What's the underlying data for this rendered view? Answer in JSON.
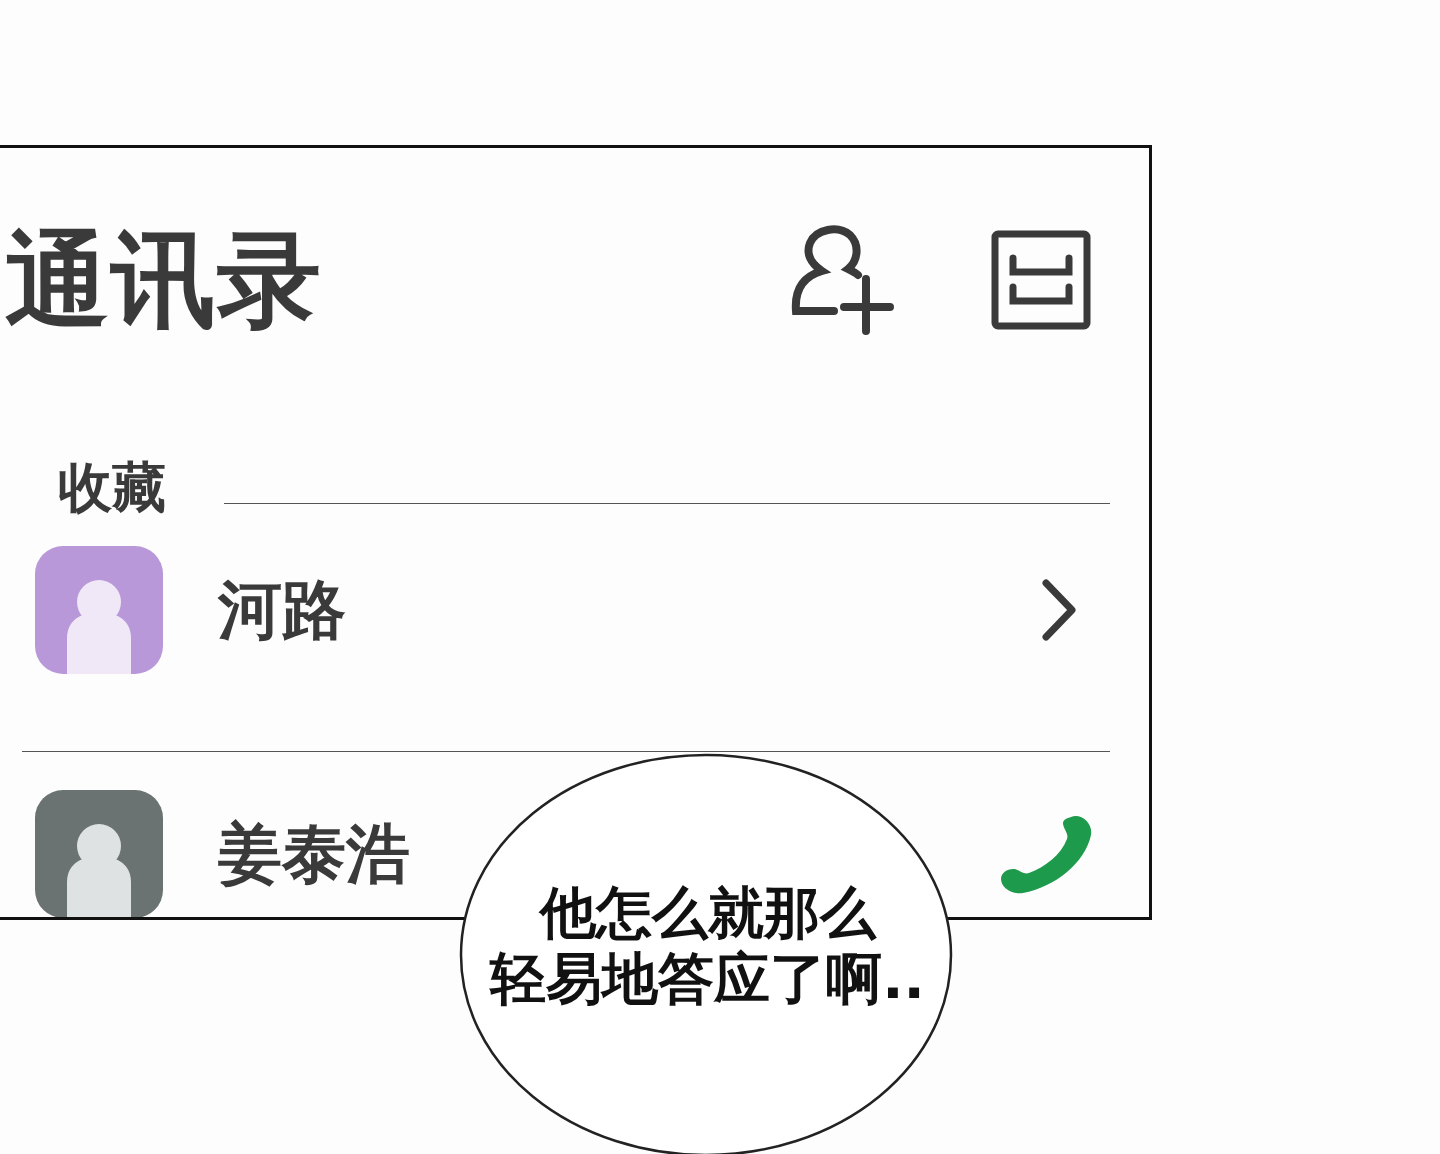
{
  "title": "通讯录",
  "section": {
    "label": "收藏"
  },
  "contacts": [
    {
      "name": "河路",
      "color": "#b898d8",
      "kind": "chevron"
    },
    {
      "name": "姜泰浩",
      "color": "#6b7372",
      "kind": "call"
    }
  ],
  "speech_bubble": {
    "lines": [
      "他怎么就那么",
      "轻易地答应了啊.."
    ]
  }
}
